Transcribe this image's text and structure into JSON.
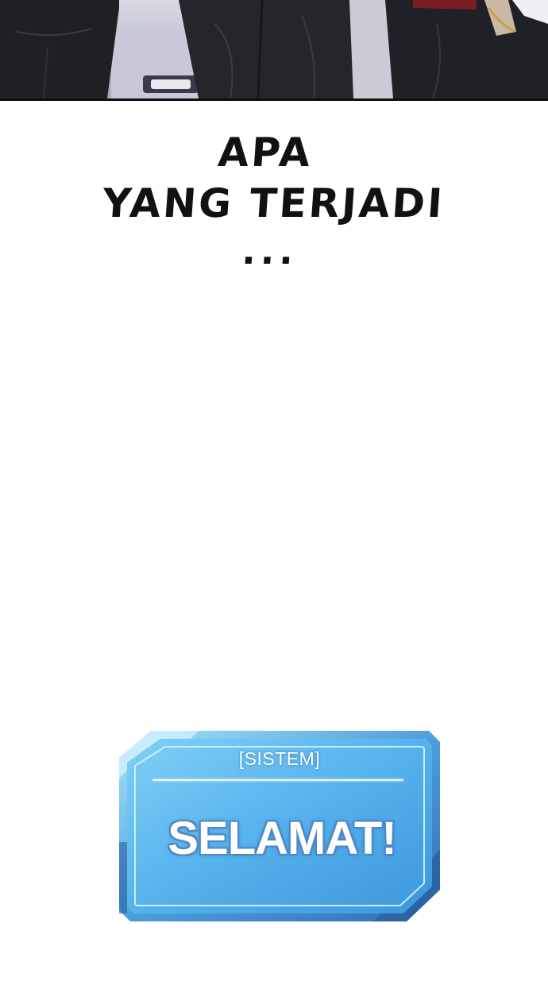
{
  "narration": {
    "line1": "APA",
    "line2": "YANG TERJADI",
    "dots": "..."
  },
  "system_panel": {
    "header": "[SISTEM]",
    "message": "SELAMAT!"
  },
  "colors": {
    "background": "#ffffff",
    "panel_blue": "#56b4ee",
    "panel_frame": "#3c80c4",
    "text_dark": "#111111"
  }
}
